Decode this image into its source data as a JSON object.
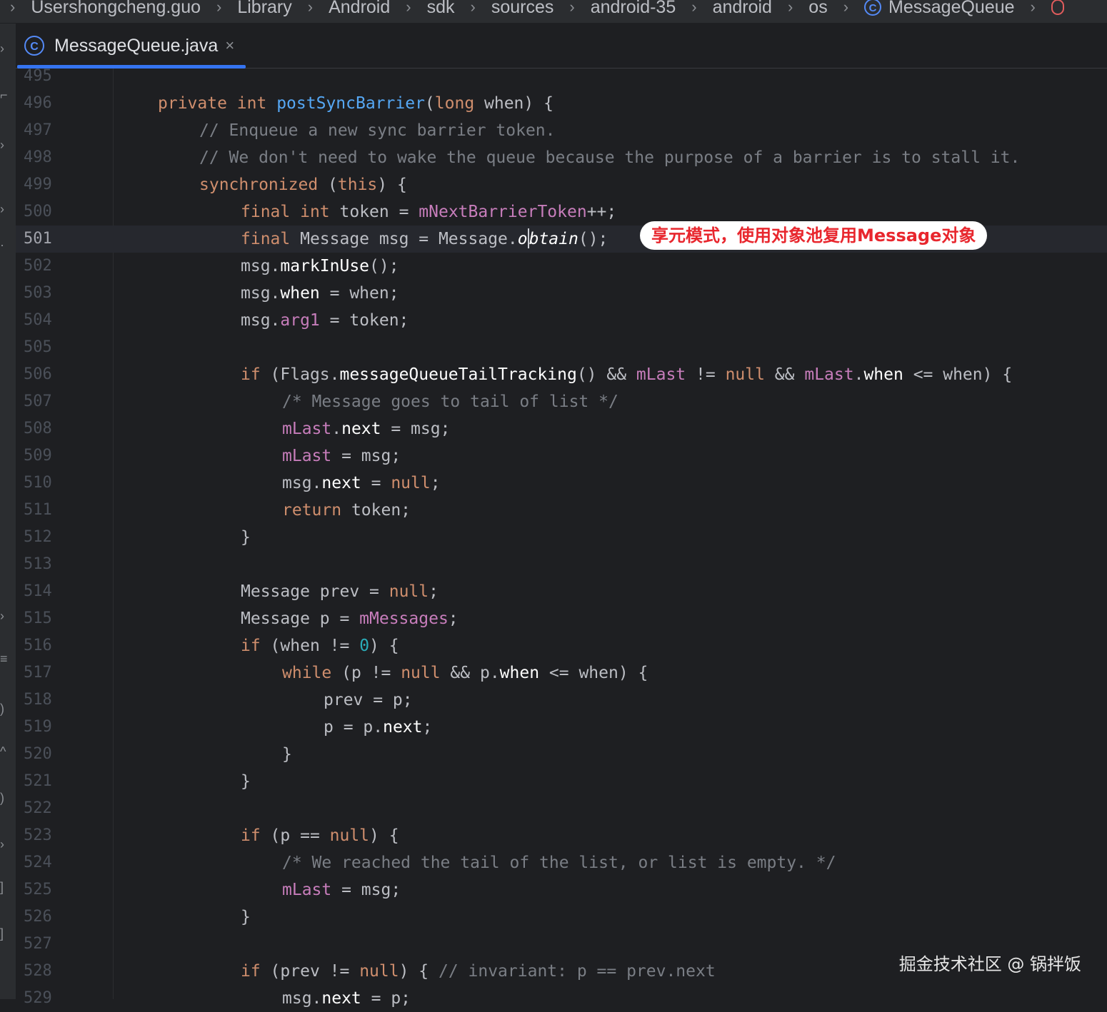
{
  "breadcrumb": [
    "Users",
    "hongcheng.guo",
    "Library",
    "Android",
    "sdk",
    "sources",
    "android-35",
    "android",
    "os",
    "MessageQueue"
  ],
  "tab": {
    "label": "MessageQueue.java",
    "close": "×",
    "icon": "java-class-icon"
  },
  "annotation": "享元模式，使用对象池复用Message对象",
  "watermark": "掘金技术社区 @ 锅拌饭",
  "line_numbers": [
    "495",
    "496",
    "497",
    "498",
    "499",
    "500",
    "501",
    "502",
    "503",
    "504",
    "505",
    "506",
    "507",
    "508",
    "509",
    "510",
    "511",
    "512",
    "513",
    "514",
    "515",
    "516",
    "517",
    "518",
    "519",
    "520",
    "521",
    "522",
    "523",
    "524",
    "525",
    "526",
    "527",
    "528",
    "529"
  ],
  "current_line": "501",
  "code": {
    "l496": {
      "kw1": "private",
      "kw2": "int",
      "fn": "postSyncBarrier",
      "p1": "(",
      "kw3": "long",
      "p2": " when) {"
    },
    "l497": "// Enqueue a new sync barrier token.",
    "l498": "// We don't need to wake the queue because the purpose of a barrier is to stall it.",
    "l499": {
      "kw1": "synchronized",
      "p1": " (",
      "kw2": "this",
      "p2": ") {"
    },
    "l500": {
      "kw1": "final",
      "kw2": "int",
      "t1": " token = ",
      "fld": "mNextBarrierToken",
      "t2": "++;"
    },
    "l501": {
      "kw1": "final",
      "t1": " Message msg = Message.",
      "m1": "o",
      "m2": "btain",
      "t2": "();"
    },
    "l502": {
      "t1": "msg.",
      "m": "markInUse",
      "t2": "();"
    },
    "l503": {
      "t1": "msg.",
      "m": "when",
      "t2": " = when;"
    },
    "l504": {
      "t1": "msg.",
      "fld": "arg1",
      "t2": " = token;"
    },
    "l506": {
      "kw1": "if",
      "t1": " (Flags.",
      "m": "messageQueueTailTracking",
      "t2": "() && ",
      "fld1": "mLast",
      "t3": " != ",
      "kw2": "null",
      "t4": " && ",
      "fld2": "mLast",
      "t5": ".",
      "m2": "when",
      "t6": " <= when) {"
    },
    "l507": "/* Message goes to tail of list */",
    "l508": {
      "fld": "mLast",
      "t1": ".",
      "m": "next",
      "t2": " = msg;"
    },
    "l509": {
      "fld": "mLast",
      "t1": " = msg;"
    },
    "l510": {
      "t1": "msg.",
      "m": "next",
      "t2": " = ",
      "kw": "null",
      "t3": ";"
    },
    "l511": {
      "kw": "return",
      "t1": " token;"
    },
    "l512": "}",
    "l514": {
      "t1": "Message prev = ",
      "kw": "null",
      "t2": ";"
    },
    "l515": {
      "t1": "Message p = ",
      "fld": "mMessages",
      "t2": ";"
    },
    "l516": {
      "kw": "if",
      "t1": " (when != ",
      "num": "0",
      "t2": ") {"
    },
    "l517": {
      "kw1": "while",
      "t1": " (p != ",
      "kw2": "null",
      "t2": " && p.",
      "m": "when",
      "t3": " <= when) {"
    },
    "l518": "prev = p;",
    "l519": {
      "t1": "p = p.",
      "m": "next",
      "t2": ";"
    },
    "l520": "}",
    "l521": "}",
    "l523": {
      "kw1": "if",
      "t1": " (p == ",
      "kw2": "null",
      "t2": ") {"
    },
    "l524": "/* We reached the tail of the list, or list is empty. */",
    "l525": {
      "fld": "mLast",
      "t1": " = msg;"
    },
    "l526": "}",
    "l528": {
      "kw1": "if",
      "t1": " (prev != ",
      "kw2": "null",
      "t2": ") { ",
      "cm": "// invariant: p == prev.next"
    },
    "l529": {
      "t1": "msg.",
      "m": "next",
      "t2": " = p;"
    }
  }
}
